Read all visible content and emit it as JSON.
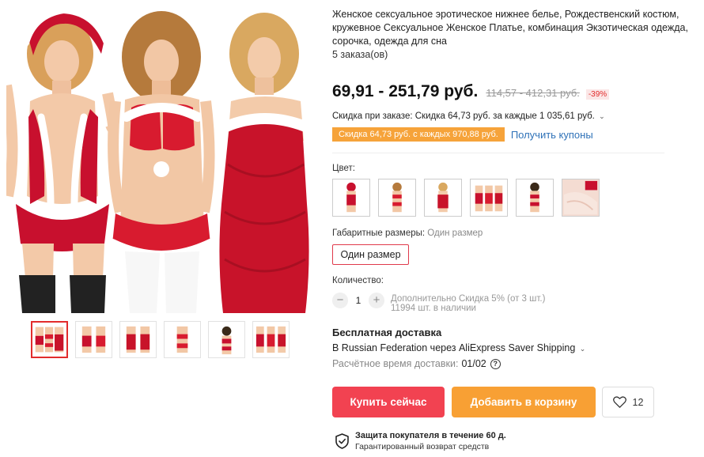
{
  "product": {
    "title": "Женское сексуальное эротическое нижнее белье, Рождественский костюм, кружевное Сексуальное Женское Платье, комбинация Экзотическая одежда, сорочка, одежда для сна",
    "orders": "5 заказа(ов)",
    "price": "69,91 - 251,79 руб.",
    "old_price": "114,57 - 412,31 руб.",
    "discount": "-39%"
  },
  "coupon": {
    "line": "Скидка при заказе: Скидка 64,73 руб. за каждые 1 035,61 руб.",
    "chevron": "⌄",
    "tag": "Скидка 64,73 руб. с каждых 970,88 руб.",
    "link": "Получить купоны"
  },
  "color": {
    "label": "Цвет:"
  },
  "size": {
    "label": "Габаритные размеры:",
    "value": "Один размер",
    "option": "Один размер"
  },
  "quantity": {
    "label": "Количество:",
    "minus": "−",
    "value": "1",
    "plus": "+",
    "note": "Дополнительно Скидка 5% (от 3 шт.)",
    "stock": "11994 шт. в наличии"
  },
  "shipping": {
    "title": "Бесплатная доставка",
    "line": "В Russian Federation через AliExpress Saver Shipping",
    "chevron": "⌄",
    "eta_label": "Расчётное время доставки:",
    "eta_value": "01/02",
    "help": "?"
  },
  "actions": {
    "buy": "Купить сейчас",
    "cart": "Добавить в корзину",
    "wish_count": "12"
  },
  "protection": {
    "title": "Защита покупателя в течение 60 д.",
    "subtitle": "Гарантированный возврат средств"
  },
  "colors": {
    "accent_red": "#f24251",
    "accent_orange": "#f8a034",
    "link_blue": "#2f72b8",
    "discount_red": "#e22c2c"
  }
}
